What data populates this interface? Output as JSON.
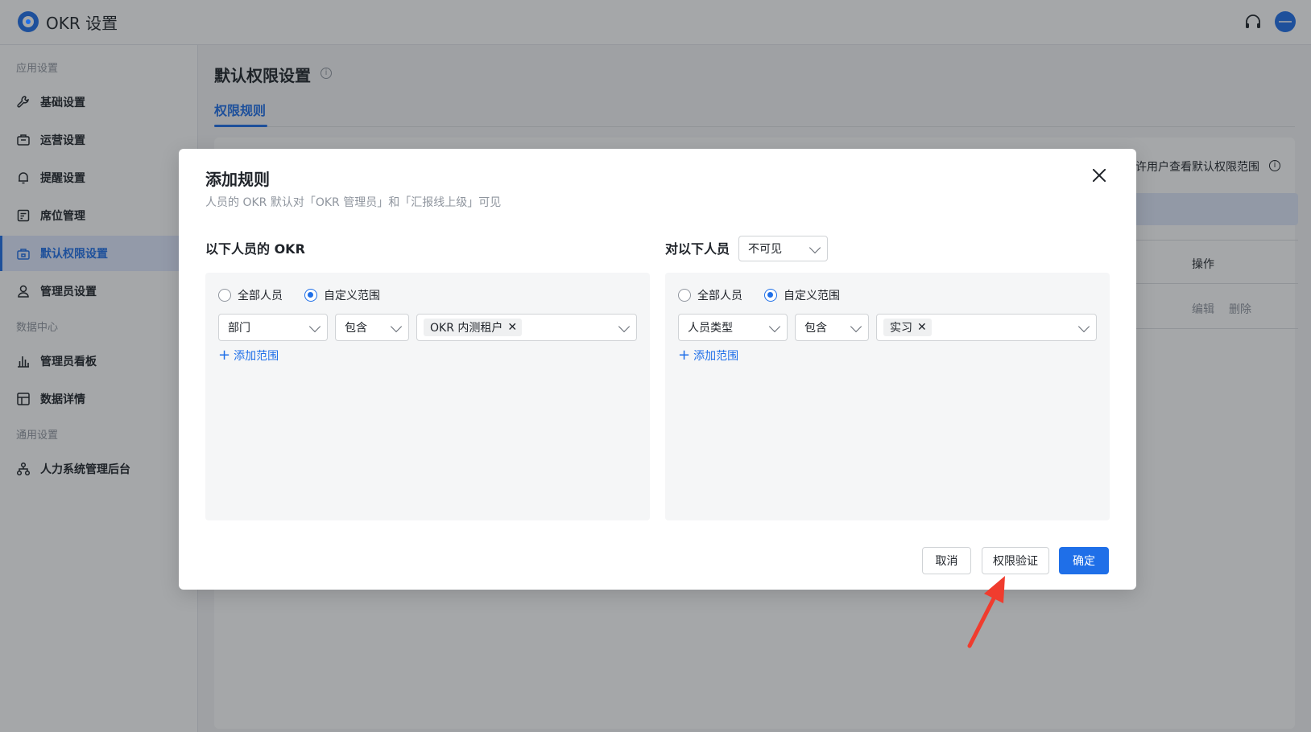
{
  "app": {
    "title": "OKR 设置"
  },
  "sidebar": {
    "groups": [
      {
        "title": "应用设置",
        "items": [
          "基础设置",
          "运营设置",
          "提醒设置",
          "席位管理",
          "默认权限设置",
          "管理员设置"
        ]
      },
      {
        "title": "数据中心",
        "items": [
          "管理员看板",
          "数据详情"
        ]
      },
      {
        "title": "通用设置",
        "items": [
          "人力系统管理后台"
        ]
      }
    ],
    "active": "默认权限设置"
  },
  "main": {
    "title": "默认权限设置",
    "tabs": [
      {
        "label": "权限规则",
        "active": true
      }
    ],
    "allow_text": "允许用户查看默认权限范围",
    "table": {
      "op_header": "操作",
      "row_actions": [
        "编辑",
        "删除"
      ]
    }
  },
  "modal": {
    "title": "添加规则",
    "subtitle": "人员的 OKR 默认对「OKR 管理员」和「汇报线上级」可见",
    "left": {
      "title": "以下人员的 OKR",
      "radio_all": "全部人员",
      "radio_custom": "自定义范围",
      "selected": "custom",
      "field": "部门",
      "operator": "包含",
      "tag": "OKR 内测租户",
      "add_range": "添加范围"
    },
    "right": {
      "title": "对以下人员",
      "visibility": "不可见",
      "radio_all": "全部人员",
      "radio_custom": "自定义范围",
      "selected": "custom",
      "field": "人员类型",
      "operator": "包含",
      "tag": "实习",
      "add_range": "添加范围"
    },
    "buttons": {
      "cancel": "取消",
      "verify": "权限验证",
      "confirm": "确定"
    }
  },
  "colors": {
    "accent": "#1f6fe8",
    "annotation": "#f03c2e"
  }
}
